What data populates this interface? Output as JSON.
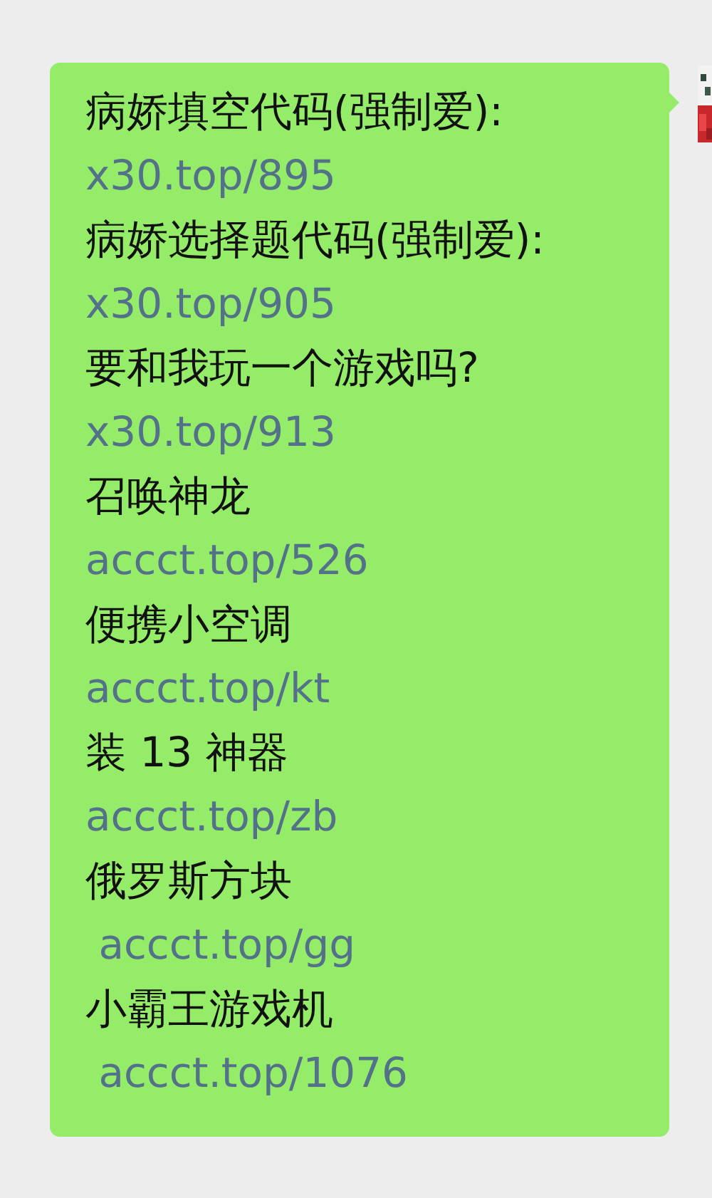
{
  "message": {
    "lines": [
      {
        "kind": "text",
        "text": "病娇填空代码(强制爱):"
      },
      {
        "kind": "link",
        "text": "x30.top/895"
      },
      {
        "kind": "text",
        "text": "病娇选择题代码(强制爱):"
      },
      {
        "kind": "link",
        "text": "x30.top/905"
      },
      {
        "kind": "text",
        "text": "要和我玩一个游戏吗?"
      },
      {
        "kind": "link",
        "text": "x30.top/913"
      },
      {
        "kind": "text",
        "text": "召唤神龙"
      },
      {
        "kind": "link",
        "text": "accct.top/526"
      },
      {
        "kind": "text",
        "text": "便携小空调"
      },
      {
        "kind": "link",
        "text": "accct.top/kt"
      },
      {
        "kind": "text",
        "text": "装 13 神器"
      },
      {
        "kind": "link",
        "text": "accct.top/zb"
      },
      {
        "kind": "text",
        "text": "俄罗斯方块"
      },
      {
        "kind": "link",
        "text": " accct.top/gg"
      },
      {
        "kind": "text",
        "text": "小霸王游戏机"
      },
      {
        "kind": "link",
        "text": " accct.top/1076"
      }
    ]
  }
}
